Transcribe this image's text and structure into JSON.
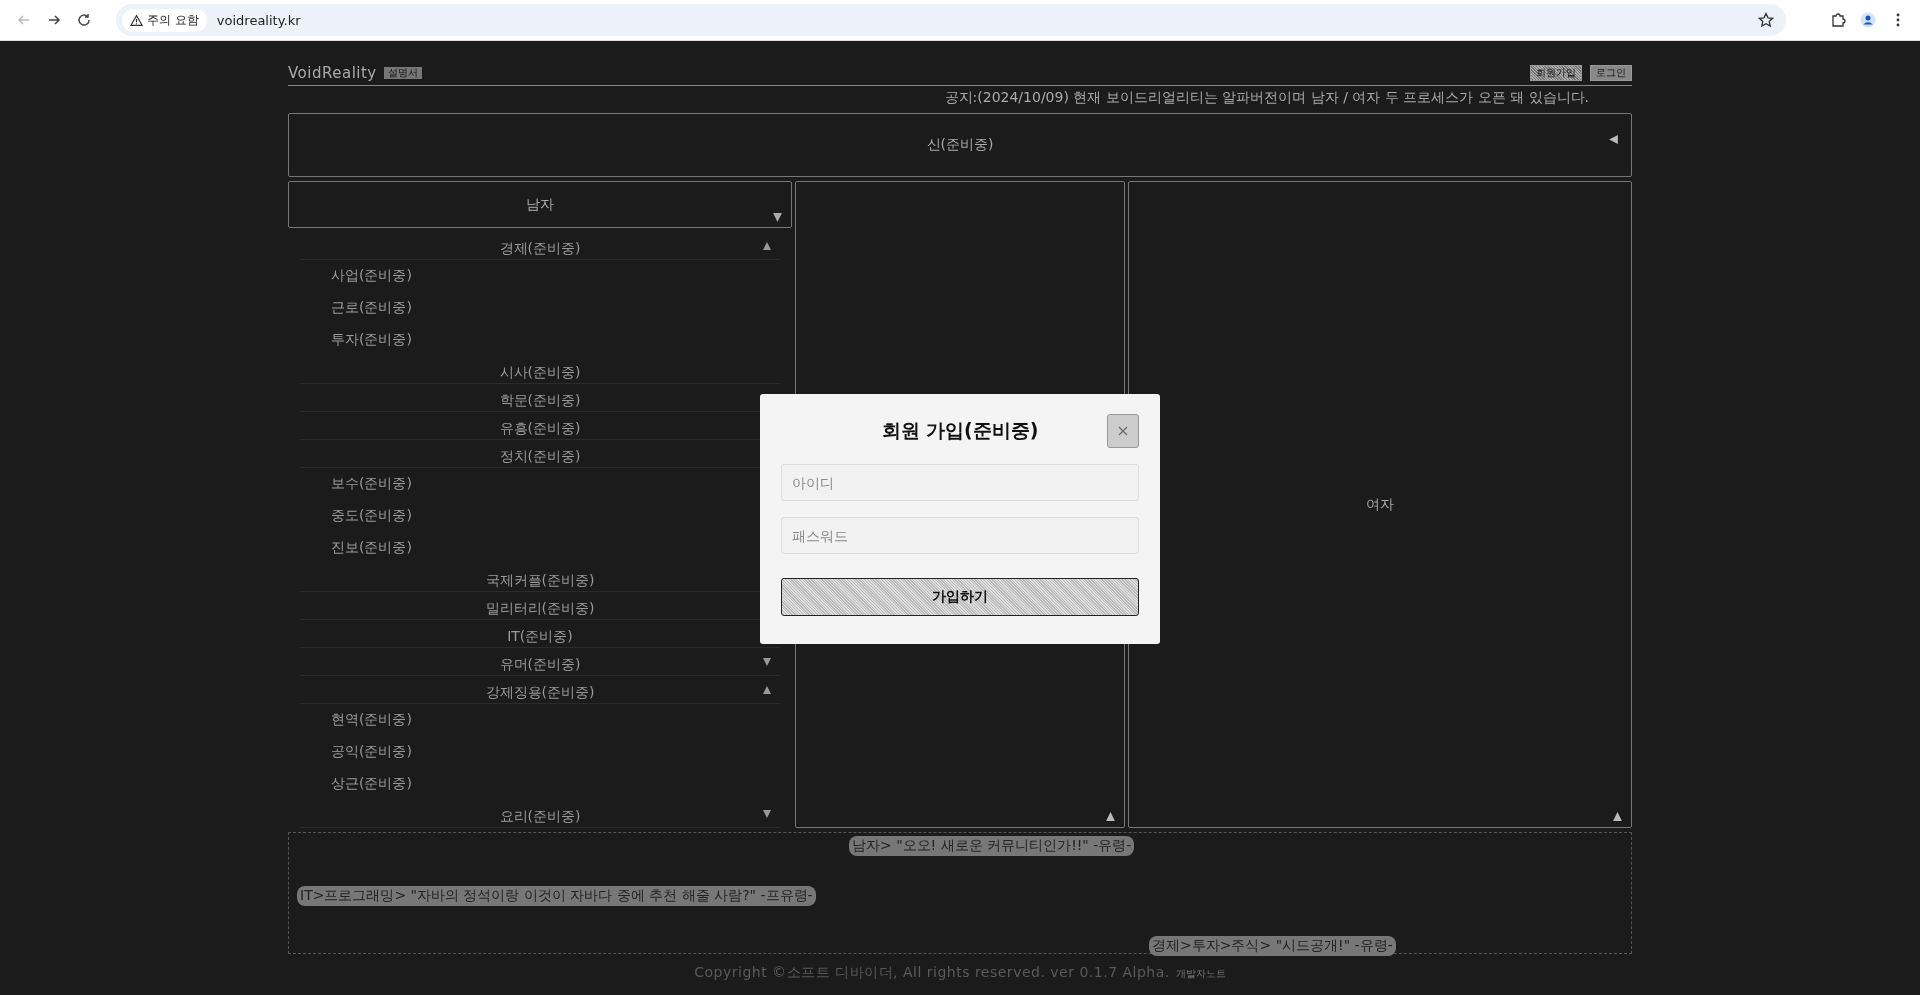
{
  "browser": {
    "security_label": "주의 요함",
    "url": "voidreality.kr"
  },
  "header": {
    "logo": "VoidReality",
    "logo_badge": "설명서",
    "buttons": [
      {
        "label": "회원가입",
        "selected": true
      },
      {
        "label": "로그인",
        "selected": false
      }
    ]
  },
  "notice": "공지:(2024/10/09) 현재 보이드리얼리티는 알파버전이며 남자 / 여자 두 프로세스가 오픈 돼 있습니다.",
  "god_panel": {
    "label": "신(준비중)"
  },
  "male_panel": {
    "title": "남자",
    "menu": [
      {
        "label": "경제(준비중)",
        "expanded": true,
        "children": [
          {
            "label": "사업(준비중)"
          },
          {
            "label": "근로(준비중)"
          },
          {
            "label": "투자(준비중)"
          }
        ]
      },
      {
        "label": "시사(준비중)"
      },
      {
        "label": "학문(준비중)"
      },
      {
        "label": "유흥(준비중)"
      },
      {
        "label": "정치(준비중)",
        "children": [
          {
            "label": "보수(준비중)"
          },
          {
            "label": "중도(준비중)"
          },
          {
            "label": "진보(준비중)"
          }
        ]
      },
      {
        "label": "국제커플(준비중)"
      },
      {
        "label": "밀리터리(준비중)"
      },
      {
        "label": "IT(준비중)"
      },
      {
        "label": "유머(준비중)",
        "expanded": false
      },
      {
        "label": "강제징용(준비중)",
        "expanded": true,
        "children": [
          {
            "label": "현역(준비중)"
          },
          {
            "label": "공익(준비중)"
          },
          {
            "label": "상근(준비중)"
          }
        ]
      },
      {
        "label": "요리(준비중)",
        "expanded": false
      }
    ]
  },
  "female_panel": {
    "label": "여자"
  },
  "feed": [
    "남자> \"오오! 새로운 커뮤니티인가!!\" -유령-",
    "IT>프로그래밍> \"자바의 정석이랑 이것이 자바다 중에 추천 해줄 사람?\" -프유령-",
    "경제>투자>주식> \"시드공개!\" -유령-"
  ],
  "footer": {
    "copyright": "Copyright ©소프트 디바이더, All rights reserved. ver 0.1.7 Alpha.",
    "link": "개발자노트"
  },
  "modal": {
    "title": "회원 가입(준비중)",
    "fields": [
      {
        "placeholder": "아이디"
      },
      {
        "placeholder": "패스워드"
      }
    ],
    "submit": "가입하기"
  }
}
